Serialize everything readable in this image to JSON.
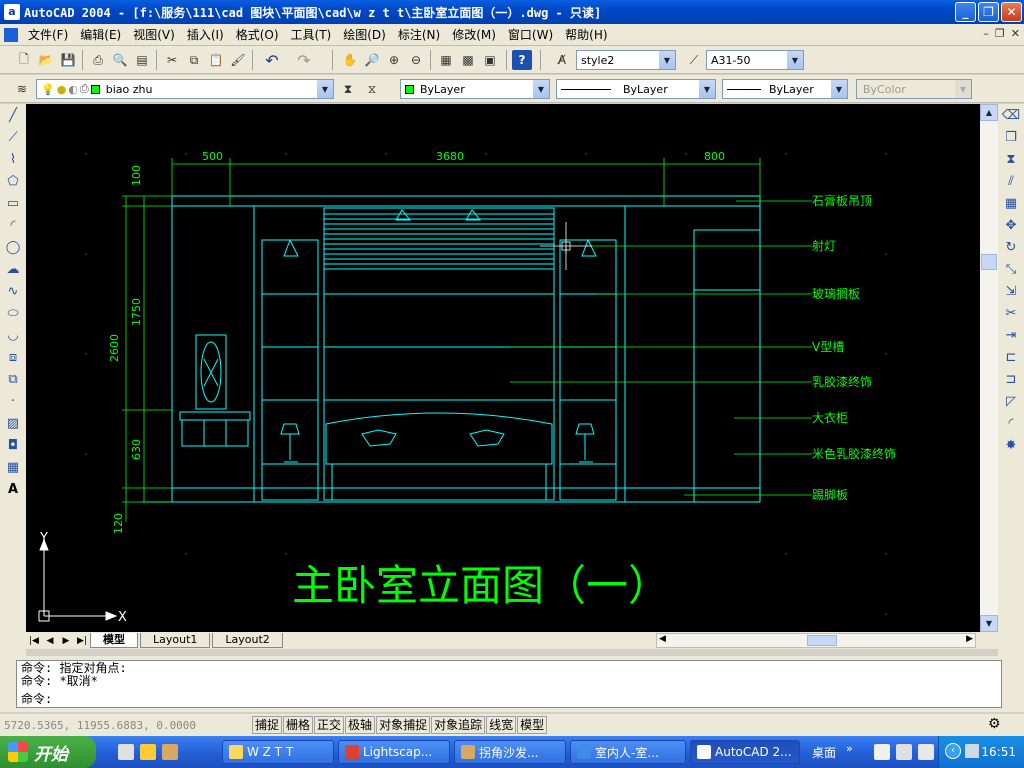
{
  "window": {
    "title": "AutoCAD 2004 - [f:\\服务\\111\\cad 图块\\平面图\\cad\\w z t t\\主卧室立面图（一）.dwg - 只读]",
    "app_icon": "a"
  },
  "menu": {
    "items": [
      "文件(F)",
      "编辑(E)",
      "视图(V)",
      "插入(I)",
      "格式(O)",
      "工具(T)",
      "绘图(D)",
      "标注(N)",
      "修改(M)",
      "窗口(W)",
      "帮助(H)"
    ]
  },
  "toolbar": {
    "text_style": "style2",
    "dim_style": "A31-50",
    "layer": "biao zhu",
    "color": "ByLayer",
    "linetype": "ByLayer",
    "lineweight": "ByLayer",
    "plotstyle": "ByColor"
  },
  "drawing": {
    "dims_top": [
      "500",
      "3680",
      "800"
    ],
    "dims_left": [
      "100",
      "1750",
      "2600",
      "630",
      "120"
    ],
    "callouts": [
      "石膏板吊顶",
      "射灯",
      "玻璃搁板",
      "V型槽",
      "乳胶漆终饰",
      "大衣柜",
      "米色乳胶漆终饰",
      "踢脚板"
    ],
    "title": "主卧室立面图（一）",
    "ucs_x": "X",
    "ucs_y": "Y",
    "line_color": "#00ffff",
    "annotation_color": "#00ff00"
  },
  "layout_tabs": [
    "模型",
    "Layout1",
    "Layout2"
  ],
  "command": {
    "lines": [
      "命令: 指定对角点:",
      "命令: *取消*",
      "命令:"
    ]
  },
  "status": {
    "coords": "5720.5365, 11955.6883, 0.0000",
    "buttons": [
      "捕捉",
      "栅格",
      "正交",
      "极轴",
      "对象捕捉",
      "对象追踪",
      "线宽",
      "模型"
    ]
  },
  "taskbar": {
    "start_label": "开始",
    "tasks": [
      "W Z T T",
      "Lightscap...",
      "拐角沙发...",
      "室内人-室...",
      "AutoCAD 2..."
    ],
    "desktop_label": "桌面",
    "clock": "16:51"
  }
}
